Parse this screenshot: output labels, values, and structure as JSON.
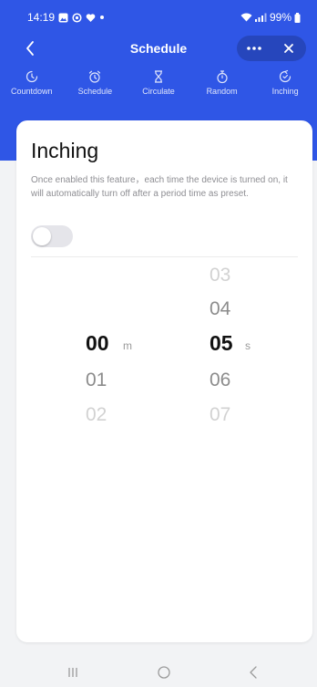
{
  "status_bar": {
    "time": "14:19",
    "battery": "99%"
  },
  "header": {
    "title": "Schedule"
  },
  "tabs": [
    {
      "label": "Countdown",
      "icon": "countdown-icon"
    },
    {
      "label": "Schedule",
      "icon": "alarm-clock-icon"
    },
    {
      "label": "Circulate",
      "icon": "hourglass-icon"
    },
    {
      "label": "Random",
      "icon": "stopwatch-icon"
    },
    {
      "label": "Inching",
      "icon": "inching-icon"
    }
  ],
  "card": {
    "title": "Inching",
    "description": "Once enabled this feature，each time the device is turned on, it will automatically turn off after a period time as preset.",
    "toggle_on": false
  },
  "picker": {
    "minutes": {
      "visible": [
        "00",
        "01",
        "02"
      ],
      "selected": "00",
      "unit": "m"
    },
    "seconds": {
      "visible": [
        "03",
        "04",
        "05",
        "06",
        "07"
      ],
      "selected": "05",
      "unit": "s"
    }
  },
  "colors": {
    "header": "#2f56e6",
    "background": "#f2f3f5",
    "card": "#ffffff"
  }
}
